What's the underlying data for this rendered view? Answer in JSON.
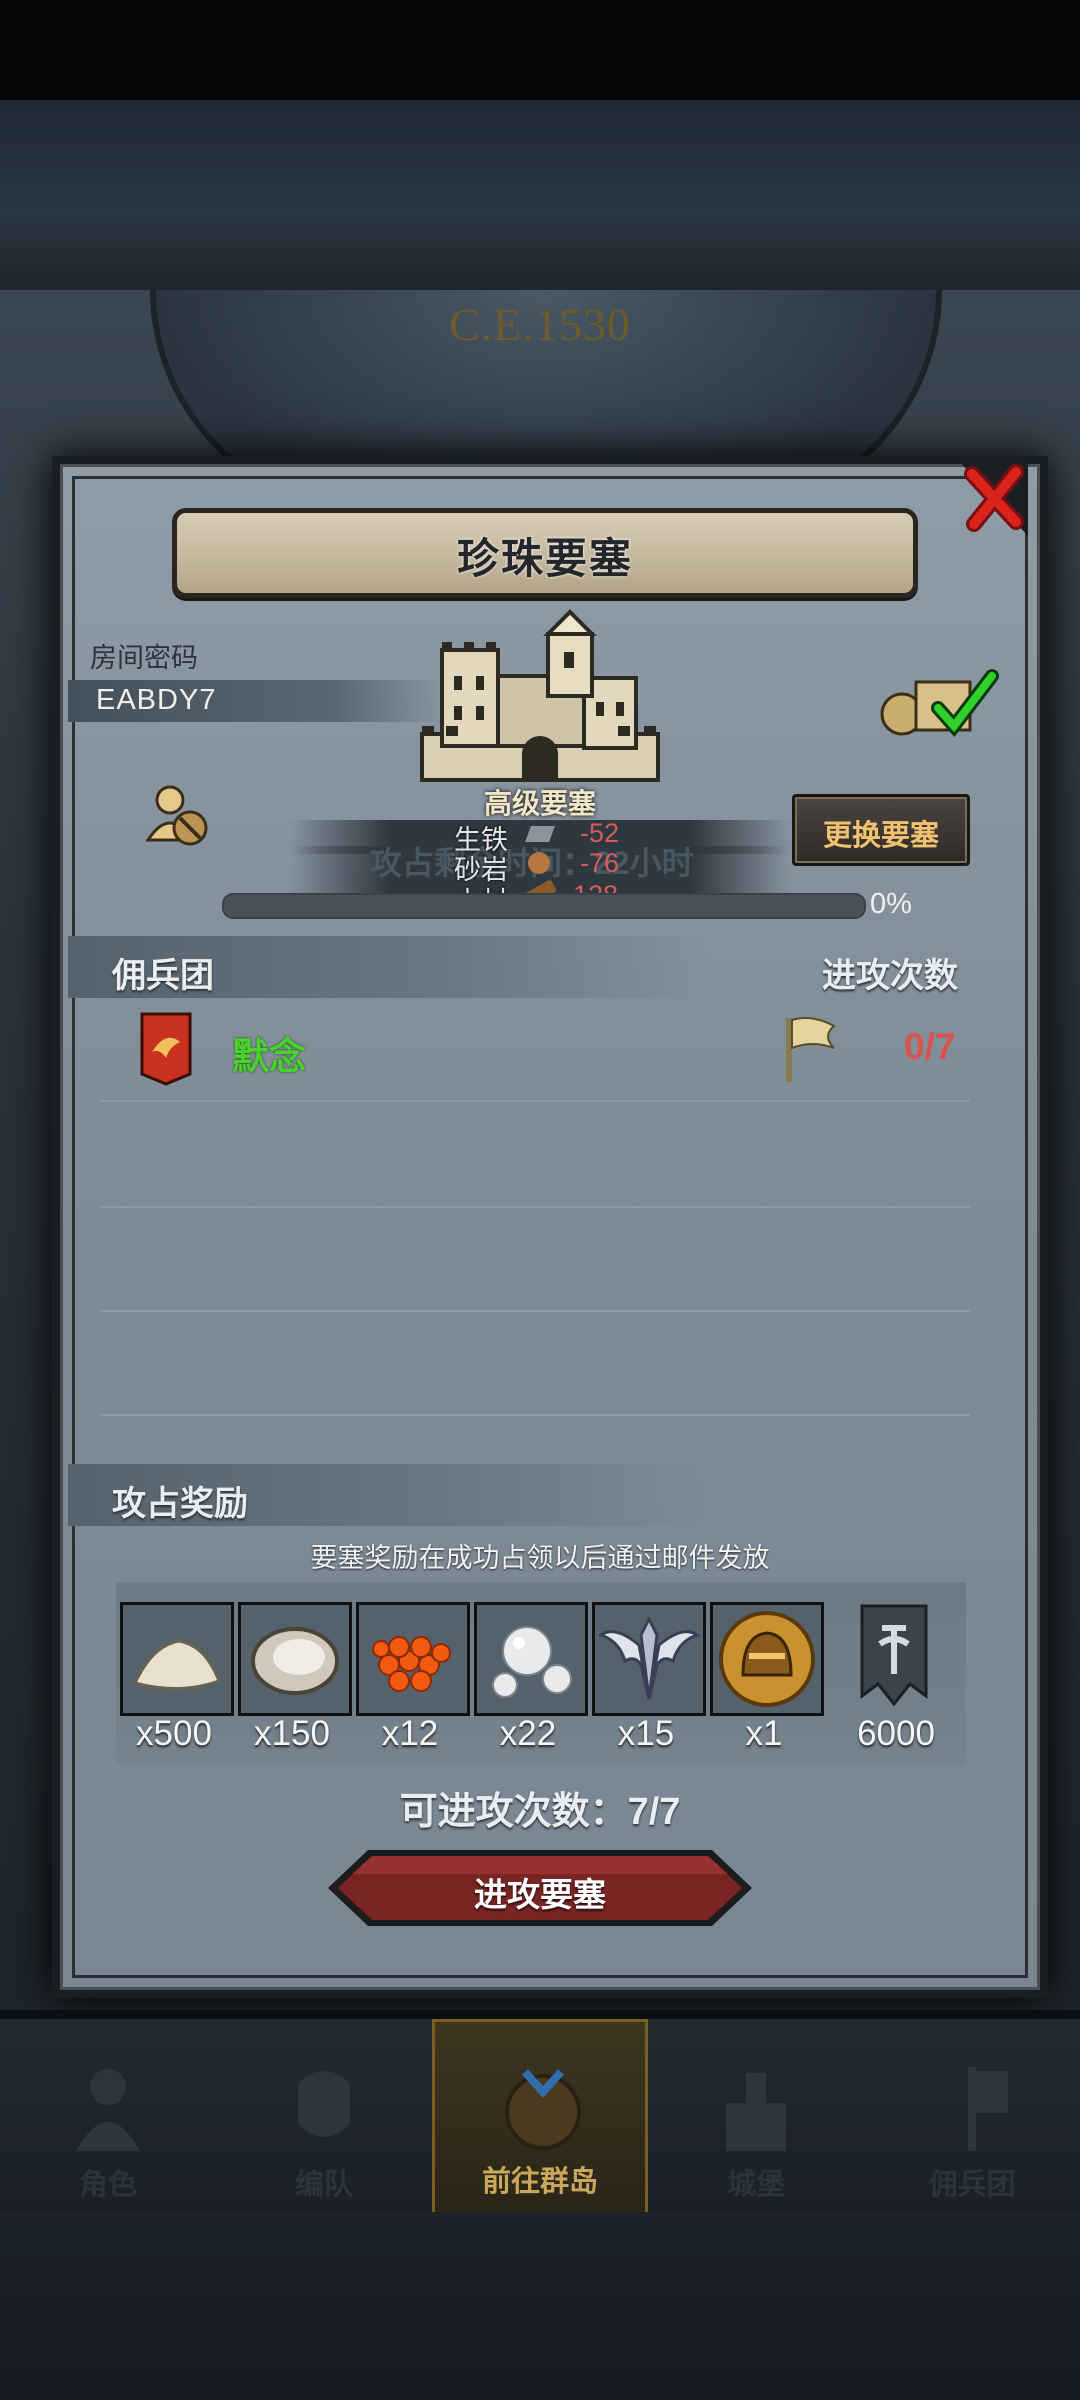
{
  "era": {
    "label": "C.E.1530"
  },
  "dialog": {
    "title": "珍珠要塞",
    "room_code_label": "房间密码",
    "room_code": "EABDY7",
    "fortress_level": "高级要塞",
    "change_button": "更换要塞",
    "progress_percent": "0%",
    "progress_value": 0,
    "overlapping_text": "攻占剩余时间：22小时",
    "resources": [
      {
        "name": "生铁",
        "value": "-52",
        "icon": "iron-icon"
      },
      {
        "name": "砂岩",
        "value": "-76",
        "icon": "sandstone-icon"
      },
      {
        "name": "木材",
        "value": "-128",
        "icon": "wood-icon"
      }
    ],
    "mercenary_header": "佣兵团",
    "attack_count_header": "进攻次数",
    "mercenaries": [
      {
        "name": "默念",
        "attacks": "0/7",
        "banner_color": "#c8321e"
      }
    ],
    "reward_header": "攻占奖励",
    "reward_note": "要塞奖励在成功占领以后通过邮件发放",
    "rewards": [
      {
        "icon": "sand-pile-icon",
        "qty": "x500"
      },
      {
        "icon": "oyster-icon",
        "qty": "x150"
      },
      {
        "icon": "fish-roe-icon",
        "qty": "x12"
      },
      {
        "icon": "pearl-icon",
        "qty": "x22"
      },
      {
        "icon": "winged-crest-icon",
        "qty": "x15"
      },
      {
        "icon": "knight-helmet-coin-icon",
        "qty": "x1"
      },
      {
        "icon": "guild-banner-icon",
        "qty": "6000"
      }
    ],
    "attempts_text": "可进攻次数：7/7",
    "attack_button": "进攻要塞"
  },
  "nav": {
    "items": [
      {
        "label": "角色",
        "icon": "character-icon"
      },
      {
        "label": "编队",
        "icon": "formation-icon"
      },
      {
        "label": "前往群岛",
        "icon": "compass-icon",
        "active": true
      },
      {
        "label": "城堡",
        "icon": "castle-icon"
      },
      {
        "label": "佣兵团",
        "icon": "mercenary-icon"
      }
    ]
  },
  "colors": {
    "accent_gold": "#caa85a",
    "merc_name": "#4bd12f",
    "attack_count": "#d9534f",
    "negative_value": "#d85a5a"
  }
}
